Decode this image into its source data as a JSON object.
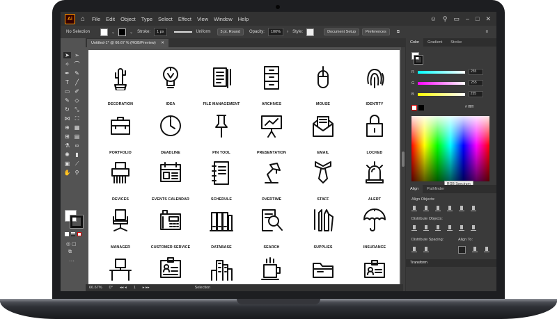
{
  "menubar": {
    "logo": "Ai",
    "items": [
      "File",
      "Edit",
      "Object",
      "Type",
      "Select",
      "Effect",
      "View",
      "Window",
      "Help"
    ]
  },
  "control": {
    "selection": "No Selection",
    "stroke_label": "Stroke:",
    "stroke_value": "1 px",
    "profile": "Uniform",
    "brush": "3 pt. Round",
    "opacity_label": "Opacity:",
    "opacity_value": "100%",
    "style_label": "Style:",
    "doc_setup": "Document Setup",
    "preferences": "Preferences"
  },
  "document": {
    "tab": "Untitled-1* @ 66.67 % (RGB/Preview)"
  },
  "icons": [
    {
      "label": "DECORATION",
      "icon": "cactus-icon"
    },
    {
      "label": "IDEA",
      "icon": "lightbulb-icon"
    },
    {
      "label": "FILE MANAGEMENT",
      "icon": "documents-icon"
    },
    {
      "label": "ARCHIVES",
      "icon": "cabinet-icon"
    },
    {
      "label": "MOUSE",
      "icon": "mouse-icon"
    },
    {
      "label": "IDENTITY",
      "icon": "fingerprint-icon"
    },
    {
      "label": "PORTFOLIO",
      "icon": "briefcase-icon"
    },
    {
      "label": "DEADLINE",
      "icon": "clock-icon"
    },
    {
      "label": "PIN TOOL",
      "icon": "pushpin-icon"
    },
    {
      "label": "PRESENTATION",
      "icon": "easel-icon"
    },
    {
      "label": "EMAIL",
      "icon": "envelope-icon"
    },
    {
      "label": "LOCKED",
      "icon": "padlock-icon"
    },
    {
      "label": "DEVICES",
      "icon": "shredder-icon"
    },
    {
      "label": "EVENTS CALENDAR",
      "icon": "calendar-icon"
    },
    {
      "label": "SCHEDULE",
      "icon": "notebook-icon"
    },
    {
      "label": "OVERTIME",
      "icon": "desk-lamp-icon"
    },
    {
      "label": "STAFF",
      "icon": "tie-icon"
    },
    {
      "label": "ALERT",
      "icon": "siren-icon"
    },
    {
      "label": "MANAGER",
      "icon": "office-chair-icon"
    },
    {
      "label": "CUSTOMER SERVICE",
      "icon": "telephone-icon"
    },
    {
      "label": "DATABASE",
      "icon": "binders-icon"
    },
    {
      "label": "SEARCH",
      "icon": "magnifier-icon"
    },
    {
      "label": "SUPPLIES",
      "icon": "pencils-icon"
    },
    {
      "label": "INSURANCE",
      "icon": "umbrella-icon"
    },
    {
      "label": "",
      "icon": "desk-computer-icon"
    },
    {
      "label": "",
      "icon": "id-badge-icon"
    },
    {
      "label": "",
      "icon": "buildings-icon"
    },
    {
      "label": "",
      "icon": "coffee-cup-icon"
    },
    {
      "label": "",
      "icon": "folder-icon"
    },
    {
      "label": "",
      "icon": "id-card-icon"
    }
  ],
  "status": {
    "zoom": "66.67%",
    "rotation": "0°",
    "artboard": "1",
    "mode": "Selection"
  },
  "panels": {
    "color_tabs": [
      "Color",
      "Gradient",
      "Stroke"
    ],
    "r_label": "R",
    "g_label": "G",
    "b_label": "B",
    "r_value": "255",
    "g_value": "255",
    "b_value": "255",
    "hex": "ffffff",
    "spectrum_tooltip": "RGB Spectrum",
    "align_tabs": [
      "Align",
      "Pathfinder"
    ],
    "align_objects": "Align Objects:",
    "distribute_objects": "Distribute Objects:",
    "distribute_spacing": "Distribute Spacing:",
    "align_to": "Align To:",
    "transform": "Transform"
  }
}
